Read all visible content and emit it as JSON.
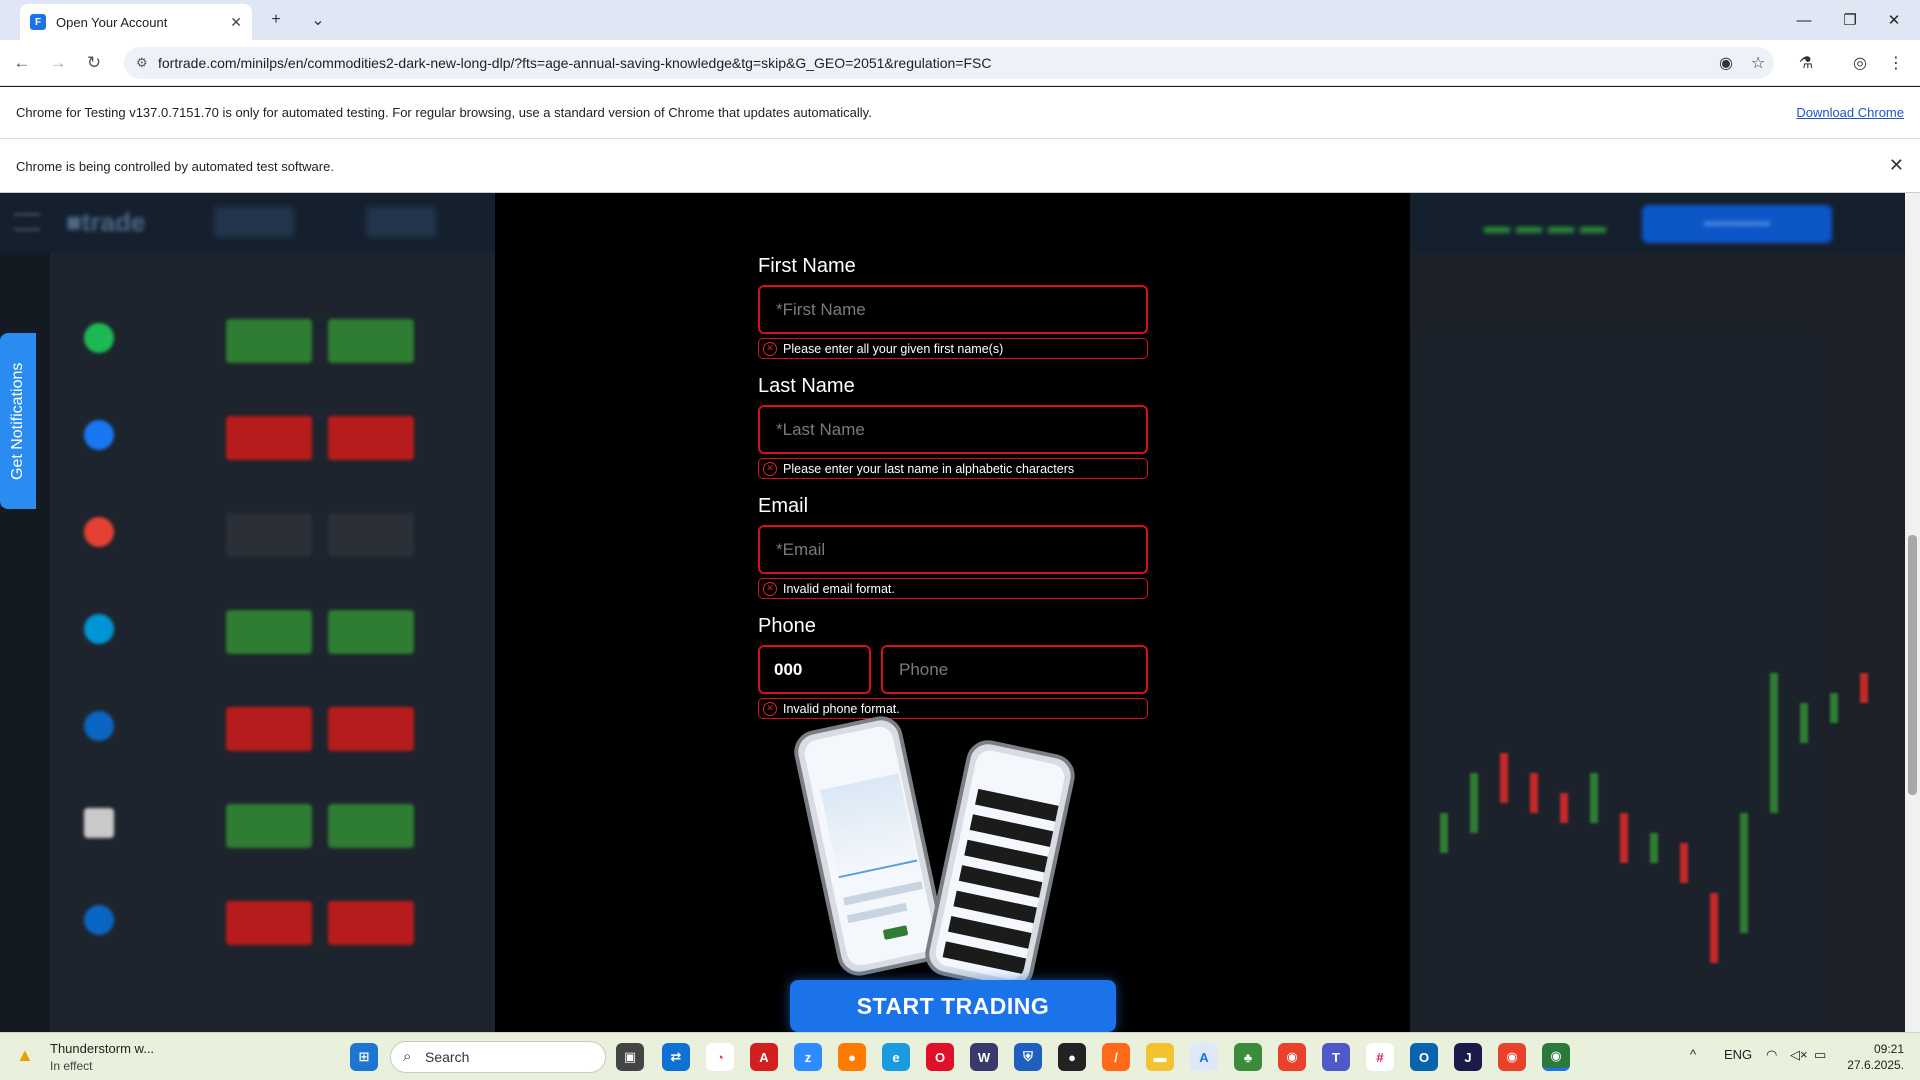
{
  "browser": {
    "tab_title": "Open Your Account",
    "url": "fortrade.com/minilps/en/commodities2-dark-new-long-dlp/?fts=age-annual-saving-knowledge&tg=skip&G_GEO=2051&regulation=FSC",
    "testing_notice": "Chrome for Testing v137.0.7151.70 is only for automated testing. For regular browsing, use a standard version of Chrome that updates automatically.",
    "download_link": "Download Chrome",
    "automation_notice": "Chrome is being controlled by automated test software."
  },
  "background": {
    "notifications_tab": "Get Notifications"
  },
  "form": {
    "first_name": {
      "label": "First Name",
      "placeholder": "*First Name",
      "error": "Please enter all your given first name(s)"
    },
    "last_name": {
      "label": "Last Name",
      "placeholder": "*Last Name",
      "error": "Please enter your last name in alphabetic characters"
    },
    "email": {
      "label": "Email",
      "placeholder": "*Email",
      "error": "Invalid email format."
    },
    "phone": {
      "label": "Phone",
      "country_code": "000",
      "placeholder": "Phone",
      "error": "Invalid phone format."
    },
    "submit_label": "START TRADING"
  },
  "taskbar": {
    "weather_title": "Thunderstorm w...",
    "weather_sub": "In effect",
    "search_placeholder": "Search",
    "language": "ENG",
    "time": "09:21",
    "date": "27.6.2025."
  },
  "colors": {
    "accent": "#1a73e8",
    "error": "#d4121f",
    "modal_bg": "#000000"
  }
}
